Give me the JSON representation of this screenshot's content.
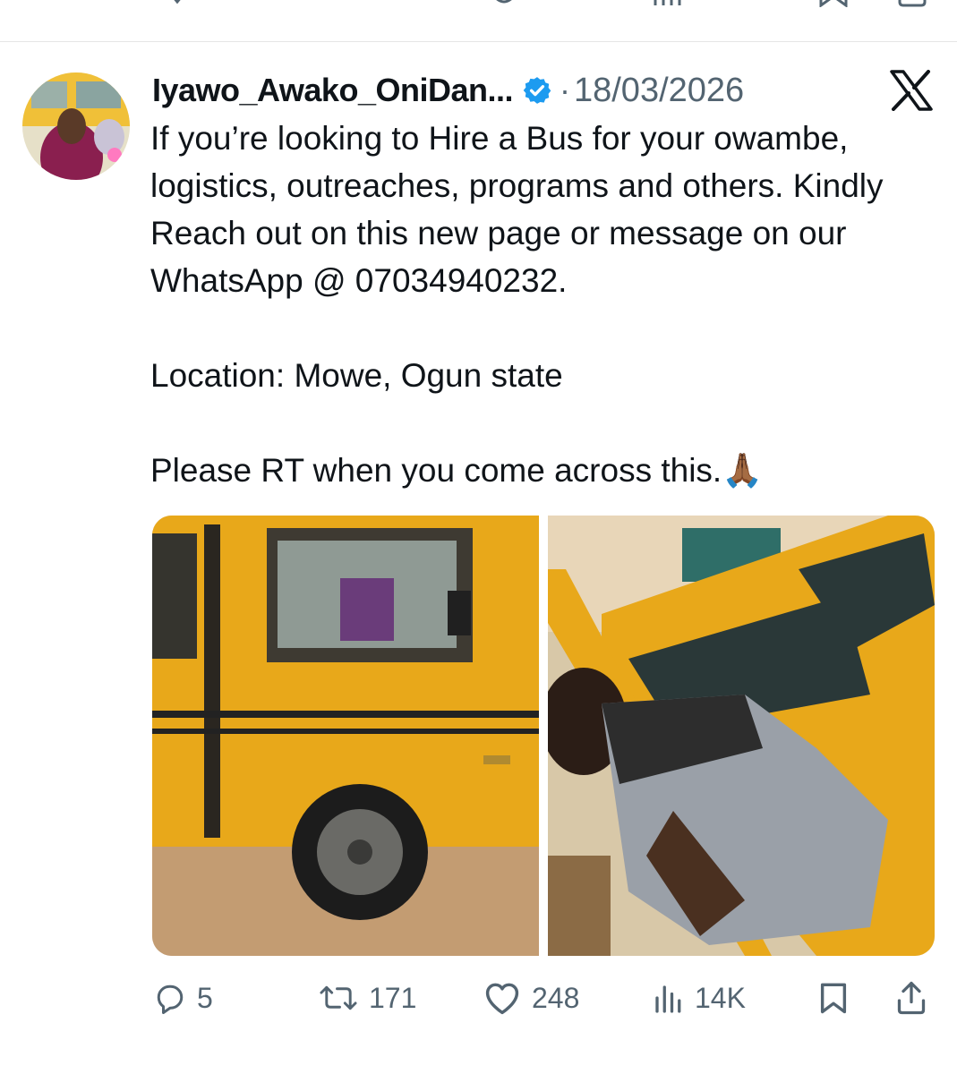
{
  "tweet": {
    "author": {
      "display_name": "Iyawo_Awako_OniDan...",
      "verified": true,
      "avatar_icon": "avatar-photo"
    },
    "separator": "·",
    "timestamp": "18/03/2026",
    "platform_icon": "x-logo-icon",
    "text": {
      "paragraph_1": "If you’re looking to Hire a Bus for your owambe, logistics, outreaches, programs and others. Kindly Reach out on this new page or message on our WhatsApp @ 07034940232.",
      "paragraph_2": "Location: Mowe, Ogun state",
      "paragraph_3": "Please RT when you come across this.🙏🏾"
    },
    "media": [
      {
        "kind": "photo",
        "icon": "yellow-bus-side-photo"
      },
      {
        "kind": "photo",
        "icon": "man-at-bus-window-photo"
      }
    ],
    "metrics": {
      "replies": "5",
      "reposts": "171",
      "likes": "248",
      "views": "14K"
    }
  },
  "colors": {
    "text_primary": "#0f1419",
    "text_secondary": "#536471",
    "verified_blue": "#1d9bf0",
    "divider": "#e6e6e6",
    "bus_yellow": "#e8a81a"
  }
}
